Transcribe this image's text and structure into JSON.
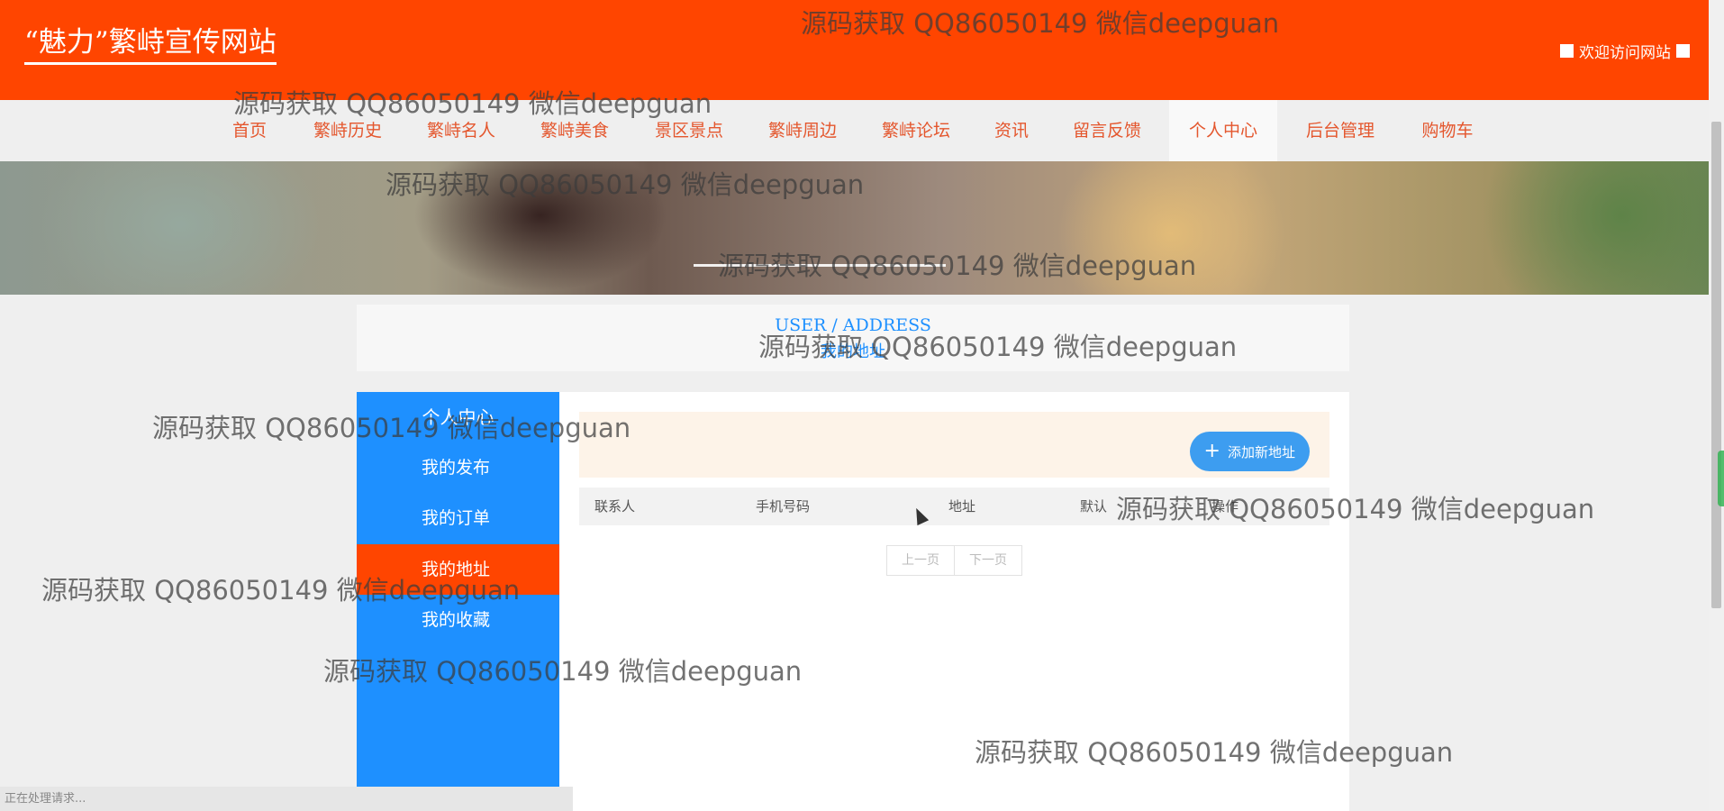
{
  "header": {
    "site_title": "“魅力”繁峙宣传网站",
    "welcome_text": "欢迎访问网站"
  },
  "nav": {
    "items": [
      {
        "label": "首页"
      },
      {
        "label": "繁峙历史"
      },
      {
        "label": "繁峙名人"
      },
      {
        "label": "繁峙美食"
      },
      {
        "label": "景区景点"
      },
      {
        "label": "繁峙周边"
      },
      {
        "label": "繁峙论坛"
      },
      {
        "label": "资讯"
      },
      {
        "label": "留言反馈"
      },
      {
        "label": "个人中心",
        "active": true
      },
      {
        "label": "后台管理"
      },
      {
        "label": "购物车"
      }
    ]
  },
  "page_title": {
    "en": "USER / ADDRESS",
    "cn": "我的地址"
  },
  "sidebar": {
    "heading": "个人中心",
    "items": [
      {
        "label": "我的发布"
      },
      {
        "label": "我的订单"
      },
      {
        "label": "我的地址",
        "active": true
      },
      {
        "label": "我的收藏"
      }
    ]
  },
  "address_panel": {
    "add_button": "添加新地址",
    "columns": [
      "联系人",
      "手机号码",
      "地址",
      "默认",
      "操作"
    ],
    "pager": {
      "prev": "上一页",
      "next": "下一页"
    }
  },
  "status_bar": {
    "text": "正在处理请求..."
  },
  "watermark": {
    "text": "源码获取 QQ86050149 微信deepguan"
  },
  "colors": {
    "header_bg": "#ff4500",
    "nav_text": "#e4572e",
    "sidebar_bg": "#1e90ff",
    "sidebar_active": "#ff4500",
    "button_bg": "#3d9df0",
    "toolbar_bg": "#fdf3e8"
  },
  "icons": {
    "welcome_left": "white-square-icon",
    "welcome_right": "white-square-icon",
    "add_button": "plus-icon",
    "cursor": "mouse-pointer-icon"
  }
}
